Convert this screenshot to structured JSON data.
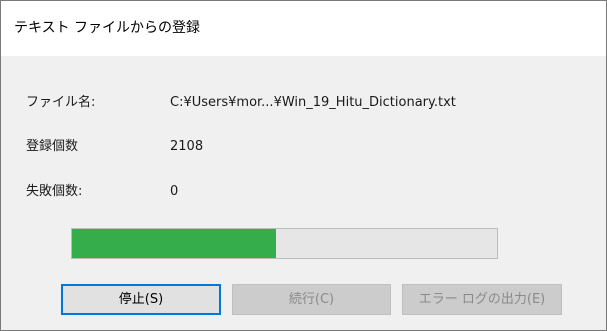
{
  "window": {
    "title": "テキスト ファイルからの登録"
  },
  "fields": {
    "file_label": "ファイル名:",
    "file_value": "C:¥Users¥mor...¥Win_19_Hitu_Dictionary.txt",
    "registered_label": "登録個数",
    "registered_value": "2108",
    "failed_label": "失敗個数:",
    "failed_value": "0"
  },
  "progress": {
    "fraction": 0.48,
    "fill_color": "#35ad4b",
    "track_color": "#e6e6e6"
  },
  "buttons": {
    "stop_label": "停止(S)",
    "continue_label": "続行(C)",
    "error_log_label": "エラー ログの出力(E)"
  },
  "colors": {
    "accent": "#0078d7",
    "disabled_text": "#8a8a8a"
  }
}
